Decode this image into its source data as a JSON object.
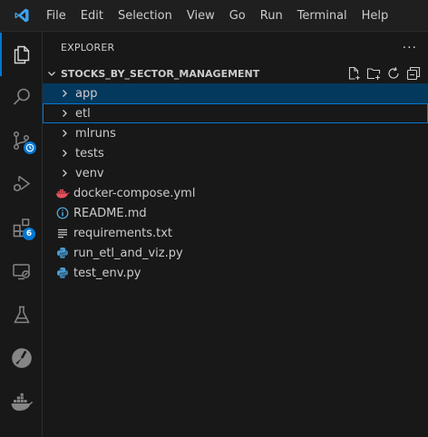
{
  "menu": [
    "File",
    "Edit",
    "Selection",
    "View",
    "Go",
    "Run",
    "Terminal",
    "Help"
  ],
  "activity_bar": {
    "extensions_badge": "6"
  },
  "explorer": {
    "title": "EXPLORER",
    "more": "···",
    "section_title": "STOCKS_BY_SECTOR_MANAGEMENT"
  },
  "tree": [
    {
      "name": "app",
      "type": "folder",
      "selected": true
    },
    {
      "name": "etl",
      "type": "folder",
      "focused": true
    },
    {
      "name": "mlruns",
      "type": "folder"
    },
    {
      "name": "tests",
      "type": "folder"
    },
    {
      "name": "venv",
      "type": "folder"
    },
    {
      "name": "docker-compose.yml",
      "type": "file",
      "icon": "docker-icon"
    },
    {
      "name": "README.md",
      "type": "file",
      "icon": "info-icon"
    },
    {
      "name": "requirements.txt",
      "type": "file",
      "icon": "text-lines-icon"
    },
    {
      "name": "run_etl_and_viz.py",
      "type": "file",
      "icon": "python-icon"
    },
    {
      "name": "test_env.py",
      "type": "file",
      "icon": "python-icon"
    }
  ],
  "colors": {
    "accent": "#0078d4",
    "selection": "#04395e",
    "docker": "#e8515f",
    "python": "#4b9ed6",
    "info": "#4fb1e9"
  }
}
